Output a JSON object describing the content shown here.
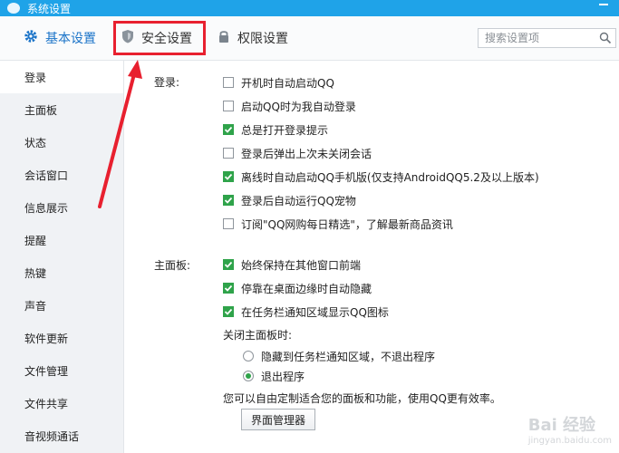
{
  "window": {
    "title": "系统设置"
  },
  "tabs": [
    {
      "label": "基本设置",
      "icon": "gear-icon"
    },
    {
      "label": "安全设置",
      "icon": "shield-icon"
    },
    {
      "label": "权限设置",
      "icon": "lock-icon"
    }
  ],
  "search": {
    "placeholder": "搜索设置项"
  },
  "sidebar": {
    "items": [
      {
        "label": "登录"
      },
      {
        "label": "主面板"
      },
      {
        "label": "状态"
      },
      {
        "label": "会话窗口"
      },
      {
        "label": "信息展示"
      },
      {
        "label": "提醒"
      },
      {
        "label": "热键"
      },
      {
        "label": "声音"
      },
      {
        "label": "软件更新"
      },
      {
        "label": "文件管理"
      },
      {
        "label": "文件共享"
      },
      {
        "label": "音视频通话"
      }
    ]
  },
  "login": {
    "label": "登录:",
    "options": [
      {
        "label": "开机时自动启动QQ",
        "checked": false
      },
      {
        "label": "启动QQ时为我自动登录",
        "checked": false
      },
      {
        "label": "总是打开登录提示",
        "checked": true
      },
      {
        "label": "登录后弹出上次未关闭会话",
        "checked": false
      },
      {
        "label": "离线时自动启动QQ手机版(仅支持AndroidQQ5.2及以上版本)",
        "checked": true
      },
      {
        "label": "登录后自动运行QQ宠物",
        "checked": true
      },
      {
        "label": "订阅\"QQ网购每日精选\"，了解最新商品资讯",
        "checked": false
      }
    ]
  },
  "panel": {
    "label": "主面板:",
    "options": [
      {
        "label": "始终保持在其他窗口前端",
        "checked": true
      },
      {
        "label": "停靠在桌面边缘时自动隐藏",
        "checked": true
      },
      {
        "label": "在任务栏通知区域显示QQ图标",
        "checked": true
      }
    ],
    "close_label": "关闭主面板时:",
    "close_options": [
      {
        "label": "隐藏到任务栏通知区域，不退出程序",
        "selected": false
      },
      {
        "label": "退出程序",
        "selected": true
      }
    ],
    "info_text": "您可以自由定制适合您的面板和功能，使用QQ更有效率。",
    "manager_button": "界面管理器"
  },
  "watermark": {
    "brand": "Bai 经验",
    "url": "jingyan.baidu.com"
  },
  "colors": {
    "titlebar": "#1fa3e8",
    "accent": "#1a73c8",
    "check": "#2fa34a",
    "highlight": "#e8202f"
  }
}
